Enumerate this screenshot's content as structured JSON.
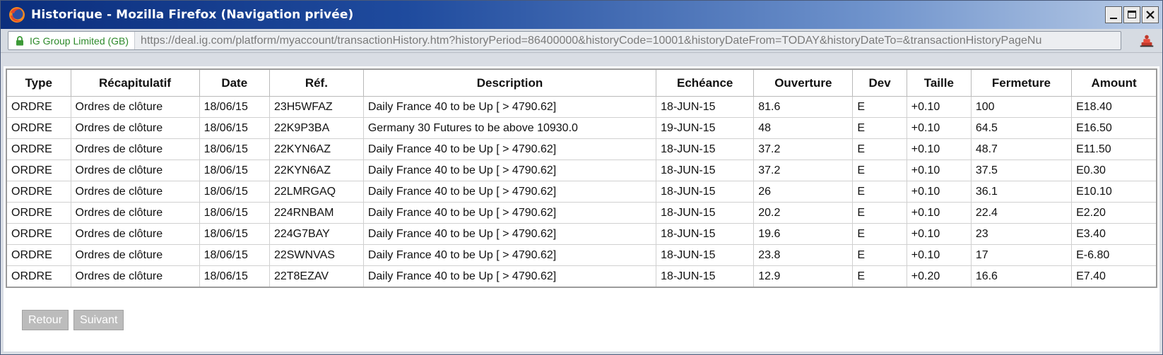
{
  "window": {
    "title": "Historique - Mozilla Firefox (Navigation privée)",
    "controls": [
      "minimize-icon",
      "maximize-icon",
      "close-icon"
    ]
  },
  "urlbar": {
    "identity": "IG Group Limited (GB)",
    "url": "https://deal.ig.com/platform/myaccount/transactionHistory.htm?historyPeriod=86400000&historyCode=10001&historyDateFrom=TODAY&historyDateTo=&transactionHistoryPageNu",
    "identity_color": "#2d8a2a"
  },
  "table": {
    "headers": [
      "Type",
      "Récapitulatif",
      "Date",
      "Réf.",
      "Description",
      "Echéance",
      "Ouverture",
      "Dev",
      "Taille",
      "Fermeture",
      "Amount"
    ],
    "rows": [
      [
        "ORDRE",
        "Ordres de clôture",
        "18/06/15",
        "23H5WFAZ",
        "Daily France 40 to be Up [ > 4790.62]",
        "18-JUN-15",
        "81.6",
        "E",
        "+0.10",
        "100",
        "E18.40"
      ],
      [
        "ORDRE",
        "Ordres de clôture",
        "18/06/15",
        "22K9P3BA",
        "Germany 30 Futures to be above 10930.0",
        "19-JUN-15",
        "48",
        "E",
        "+0.10",
        "64.5",
        "E16.50"
      ],
      [
        "ORDRE",
        "Ordres de clôture",
        "18/06/15",
        "22KYN6AZ",
        "Daily France 40 to be Up [ > 4790.62]",
        "18-JUN-15",
        "37.2",
        "E",
        "+0.10",
        "48.7",
        "E11.50"
      ],
      [
        "ORDRE",
        "Ordres de clôture",
        "18/06/15",
        "22KYN6AZ",
        "Daily France 40 to be Up [ > 4790.62]",
        "18-JUN-15",
        "37.2",
        "E",
        "+0.10",
        "37.5",
        "E0.30"
      ],
      [
        "ORDRE",
        "Ordres de clôture",
        "18/06/15",
        "22LMRGAQ",
        "Daily France 40 to be Up [ > 4790.62]",
        "18-JUN-15",
        "26",
        "E",
        "+0.10",
        "36.1",
        "E10.10"
      ],
      [
        "ORDRE",
        "Ordres de clôture",
        "18/06/15",
        "224RNBAM",
        "Daily France 40 to be Up [ > 4790.62]",
        "18-JUN-15",
        "20.2",
        "E",
        "+0.10",
        "22.4",
        "E2.20"
      ],
      [
        "ORDRE",
        "Ordres de clôture",
        "18/06/15",
        "224G7BAY",
        "Daily France 40 to be Up [ > 4790.62]",
        "18-JUN-15",
        "19.6",
        "E",
        "+0.10",
        "23",
        "E3.40"
      ],
      [
        "ORDRE",
        "Ordres de clôture",
        "18/06/15",
        "22SWNVAS",
        "Daily France 40 to be Up [ > 4790.62]",
        "18-JUN-15",
        "23.8",
        "E",
        "+0.10",
        "17",
        "E-6.80"
      ],
      [
        "ORDRE",
        "Ordres de clôture",
        "18/06/15",
        "22T8EZAV",
        "Daily France 40 to be Up [ > 4790.62]",
        "18-JUN-15",
        "12.9",
        "E",
        "+0.20",
        "16.6",
        "E7.40"
      ]
    ]
  },
  "buttons": {
    "back": "Retour",
    "next": "Suivant"
  }
}
